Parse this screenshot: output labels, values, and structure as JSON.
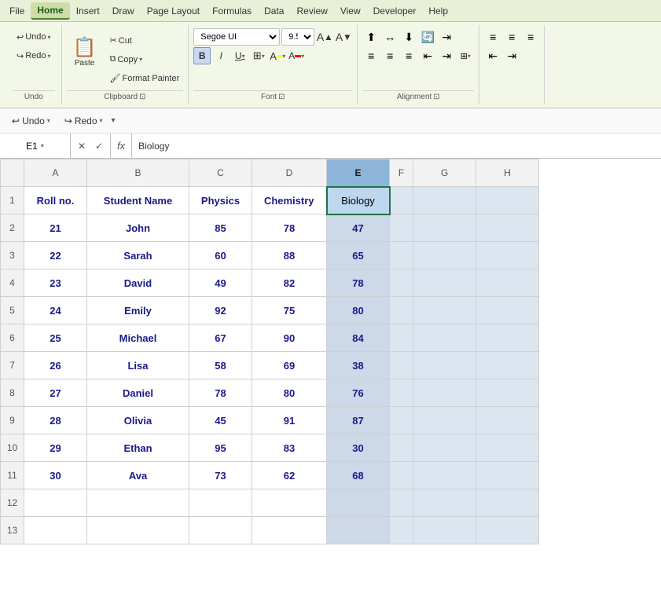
{
  "menu": {
    "items": [
      "File",
      "Home",
      "Insert",
      "Draw",
      "Page Layout",
      "Formulas",
      "Data",
      "Review",
      "View",
      "Developer",
      "Help"
    ]
  },
  "ribbon": {
    "undo_label": "Undo",
    "redo_label": "Redo",
    "clipboard": {
      "paste_label": "Paste",
      "cut_label": "Cut",
      "copy_label": "Copy",
      "format_painter_label": "Format Painter",
      "group_label": "Clipboard"
    },
    "font": {
      "font_name": "Segoe UI",
      "font_size": "9.5",
      "bold_label": "B",
      "italic_label": "I",
      "underline_label": "U",
      "group_label": "Font"
    },
    "alignment": {
      "group_label": "Alignment"
    }
  },
  "formula_bar": {
    "cell_ref": "E1",
    "formula_content": "Biology"
  },
  "spreadsheet": {
    "col_headers": [
      "",
      "A",
      "B",
      "C",
      "D",
      "E",
      "F",
      "G",
      "H"
    ],
    "rows": [
      {
        "row_num": "1",
        "A": "Roll no.",
        "B": "Student Name",
        "C": "Physics",
        "D": "Chemistry",
        "E": "Biology",
        "G": "",
        "H": ""
      },
      {
        "row_num": "2",
        "A": "21",
        "B": "John",
        "C": "85",
        "D": "78",
        "E": "47",
        "G": "",
        "H": ""
      },
      {
        "row_num": "3",
        "A": "22",
        "B": "Sarah",
        "C": "60",
        "D": "88",
        "E": "65",
        "G": "",
        "H": ""
      },
      {
        "row_num": "4",
        "A": "23",
        "B": "David",
        "C": "49",
        "D": "82",
        "E": "78",
        "G": "",
        "H": ""
      },
      {
        "row_num": "5",
        "A": "24",
        "B": "Emily",
        "C": "92",
        "D": "75",
        "E": "80",
        "G": "",
        "H": ""
      },
      {
        "row_num": "6",
        "A": "25",
        "B": "Michael",
        "C": "67",
        "D": "90",
        "E": "84",
        "G": "",
        "H": ""
      },
      {
        "row_num": "7",
        "A": "26",
        "B": "Lisa",
        "C": "58",
        "D": "69",
        "E": "38",
        "G": "",
        "H": ""
      },
      {
        "row_num": "8",
        "A": "27",
        "B": "Daniel",
        "C": "78",
        "D": "80",
        "E": "76",
        "G": "",
        "H": ""
      },
      {
        "row_num": "9",
        "A": "28",
        "B": "Olivia",
        "C": "45",
        "D": "91",
        "E": "87",
        "G": "",
        "H": ""
      },
      {
        "row_num": "10",
        "A": "29",
        "B": "Ethan",
        "C": "95",
        "D": "83",
        "E": "30",
        "G": "",
        "H": ""
      },
      {
        "row_num": "11",
        "A": "30",
        "B": "Ava",
        "C": "73",
        "D": "62",
        "E": "68",
        "G": "",
        "H": ""
      },
      {
        "row_num": "12",
        "A": "",
        "B": "",
        "C": "",
        "D": "",
        "E": "",
        "G": "",
        "H": ""
      },
      {
        "row_num": "13",
        "A": "",
        "B": "",
        "C": "",
        "D": "",
        "E": "",
        "G": "",
        "H": ""
      }
    ]
  }
}
